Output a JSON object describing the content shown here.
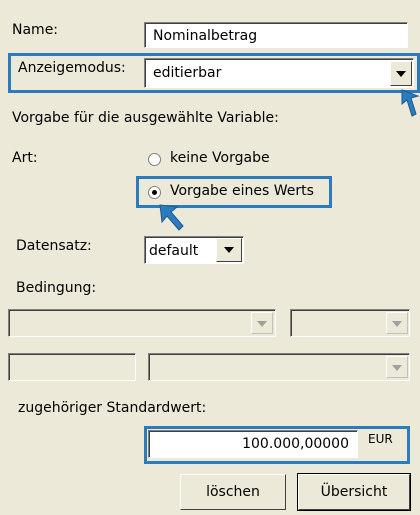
{
  "form": {
    "name_label": "Name:",
    "name_value": "Nominalbetrag",
    "mode_label": "Anzeigemodus:",
    "mode_value": "editierbar",
    "section_title": "Vorgabe für die ausgewählte Variable:",
    "art_label": "Art:",
    "radio_none": "keine Vorgabe",
    "radio_value": "Vorgabe eines Werts",
    "radio_selected": "Vorgabe eines Werts",
    "dataset_label": "Datensatz:",
    "dataset_value": "default",
    "condition_label": "Bedingung:",
    "default_label": "zugehöriger Standardwert:",
    "amount_value": "100.000,00000",
    "currency": "EUR",
    "delete_button": "löschen",
    "overview_button": "Übersicht"
  },
  "colors": {
    "highlight": "#2b7bbd",
    "window_bg": "#ece9d8"
  },
  "icons": {
    "pointer": "arrow-pointer-icon"
  }
}
